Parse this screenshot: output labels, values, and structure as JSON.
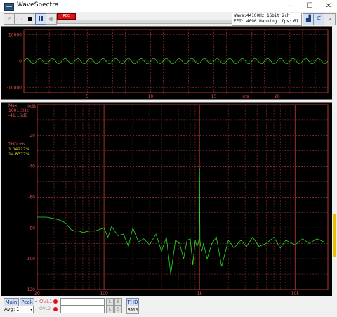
{
  "window": {
    "title": "WaveSpectra",
    "minimize_glyph": "—",
    "maximize_glyph": "☐",
    "close_glyph": "✕"
  },
  "toolbar": {
    "record_label": "REC",
    "info_line1": "Wave:44100Hz 16bit 2ch",
    "info_line2": "FFT: 4096 Hanning",
    "fps_label": "fps:",
    "fps_value": "61"
  },
  "wave": {
    "y_ticks": [
      "10000",
      "0",
      "-10000"
    ],
    "x_ticks": [
      "5",
      "10",
      "15",
      "20"
    ],
    "x_unit": "ms",
    "amplitude": 1000,
    "period_ms": 1
  },
  "spectrum": {
    "top_label": "0dB",
    "y_ticks": [
      "-20",
      "-40",
      "-60",
      "-80",
      "-100",
      "-120"
    ],
    "x_ticks": [
      "20",
      "100",
      "1k",
      "10k"
    ],
    "max_title": "Max",
    "max_freq": "1001.3Hz",
    "max_level": "-41.16dB",
    "thd_title": "THD,+N",
    "thd_value": "1.04227%",
    "thdn_value": "14.8377%"
  },
  "chart_data": [
    {
      "type": "line",
      "title": "",
      "xlabel": "ms",
      "ylabel": "",
      "xlim": [
        0,
        24
      ],
      "ylim": [
        -12000,
        12000
      ],
      "series": [
        {
          "x": [
            0,
            0.25,
            0.5,
            0.75,
            1,
            1.25,
            1.5,
            1.75,
            2
          ],
          "values": [
            0,
            1000,
            0,
            -1000,
            0,
            1000,
            0,
            -1000,
            0
          ]
        }
      ]
    },
    {
      "type": "line",
      "title": "",
      "xlabel": "Hz",
      "ylabel": "dB",
      "x_scale": "log",
      "xlim": [
        20,
        22050
      ],
      "ylim": [
        -120,
        0
      ],
      "series": [
        {
          "x": [
            20,
            25,
            30,
            35,
            40,
            45,
            50,
            55,
            60,
            70,
            80,
            90,
            100,
            110,
            120,
            140,
            160,
            180,
            200,
            230,
            260,
            300,
            350,
            400,
            450,
            500,
            560,
            620,
            680,
            740,
            800,
            850,
            900,
            940,
            970,
            990,
            1000,
            1010,
            1030,
            1060,
            1100,
            1200,
            1350,
            1500,
            1700,
            2000,
            2300,
            2700,
            3100,
            3600,
            4200,
            5000,
            6000,
            7000,
            8000,
            10000,
            12000,
            14000,
            17000,
            20000
          ],
          "values": [
            -73,
            -73,
            -74,
            -75,
            -77,
            -81,
            -82,
            -82,
            -83,
            -82,
            -82,
            -81,
            -80,
            -86,
            -79,
            -85,
            -84,
            -92,
            -80,
            -89,
            -87,
            -91,
            -84,
            -95,
            -86,
            -110,
            -88,
            -90,
            -100,
            -88,
            -87,
            -104,
            -88,
            -92,
            -90,
            -86,
            -41,
            -88,
            -92,
            -95,
            -90,
            -100,
            -90,
            -86,
            -105,
            -88,
            -93,
            -88,
            -92,
            -86,
            -92,
            -90,
            -86,
            -93,
            -88,
            -91,
            -87,
            -90,
            -87,
            -89
          ]
        }
      ]
    }
  ],
  "bottom": {
    "main_label": "Main",
    "peak_label": "Peak",
    "dash": "-",
    "ovl1_label": "OVL1",
    "ovl2_label": "OVL2",
    "avg_label": "Avg:",
    "avg_value": "1",
    "l_label": "L",
    "s_label": "S",
    "thd_button": "THD",
    "rms_button": "RMS"
  },
  "colors": {
    "trace": "#22e022",
    "grid": "#b03a2e",
    "axis_text": "#e05050",
    "thd_text": "#e0e020",
    "panel_bg": "#000000"
  }
}
